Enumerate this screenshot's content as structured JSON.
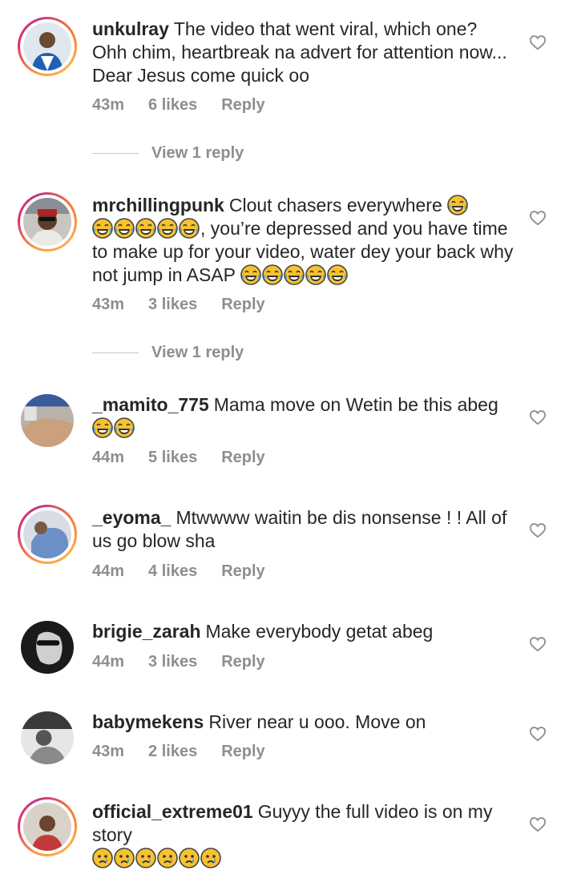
{
  "comments": [
    {
      "username": "unkulray",
      "text_parts": [
        "The video that went viral, which one? Ohh chim, heartbreak na advert for attention now... Dear Jesus come quick oo"
      ],
      "time": "43m",
      "likes": "6 likes",
      "reply": "Reply",
      "view_replies": "View 1 reply"
    },
    {
      "username": "mrchillingpunk",
      "text_parts": [
        "Clout chasers everywhere",
        ", you’re depressed and you have time to make up for your video, water dey your back why not jump in ASAP"
      ],
      "time": "43m",
      "likes": "3 likes",
      "reply": "Reply",
      "view_replies": "View 1 reply"
    },
    {
      "username": "_mamito_775",
      "text_parts": [
        "Mama move on Wetin be this abeg"
      ],
      "time": "44m",
      "likes": "5 likes",
      "reply": "Reply"
    },
    {
      "username": "_eyoma_",
      "text_parts": [
        "Mtwwww waitin be dis nonsense ! ! All of us go blow sha"
      ],
      "time": "44m",
      "likes": "4 likes",
      "reply": "Reply"
    },
    {
      "username": "brigie_zarah",
      "text_parts": [
        "Make everybody getat abeg"
      ],
      "time": "44m",
      "likes": "3 likes",
      "reply": "Reply"
    },
    {
      "username": "babymekens",
      "text_parts": [
        "River near u ooo. Move on"
      ],
      "time": "43m",
      "likes": "2 likes",
      "reply": "Reply"
    },
    {
      "username": "official_extreme01",
      "text_parts": [
        "Guyyy the full video is on my story"
      ]
    }
  ],
  "icons": {
    "heart": "heart-outline-icon",
    "laugh_emoji": "face-with-tears-of-joy",
    "cry_emoji": "crying-face"
  },
  "colors": {
    "username": "#262626",
    "meta": "#8e8e8e",
    "story_ring": "#e1306c",
    "emoji_yellow": "#f7c22f"
  }
}
